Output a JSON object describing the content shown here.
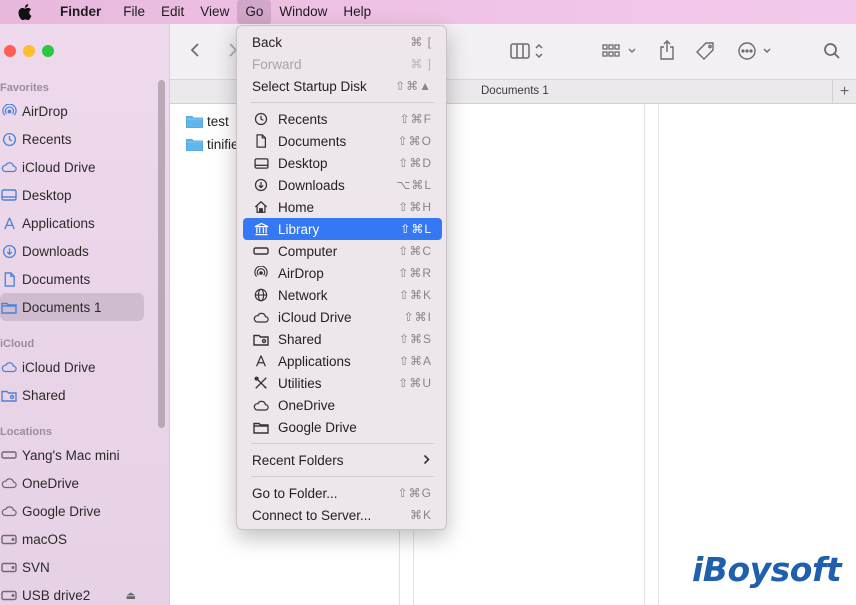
{
  "menubar": {
    "app": "Finder",
    "items": [
      "File",
      "Edit",
      "View",
      "Go",
      "Window",
      "Help"
    ],
    "active": "Go"
  },
  "sidebar": {
    "sections": {
      "favorites": "Favorites",
      "icloud": "iCloud",
      "locations": "Locations"
    },
    "favorites": [
      {
        "label": "AirDrop",
        "icon": "airdrop-icon"
      },
      {
        "label": "Recents",
        "icon": "clock-icon"
      },
      {
        "label": "iCloud Drive",
        "icon": "cloud-icon"
      },
      {
        "label": "Desktop",
        "icon": "desktop-icon"
      },
      {
        "label": "Applications",
        "icon": "applications-icon"
      },
      {
        "label": "Downloads",
        "icon": "download-icon"
      },
      {
        "label": "Documents",
        "icon": "document-icon"
      },
      {
        "label": "Documents 1",
        "icon": "folder-icon"
      }
    ],
    "icloud": [
      {
        "label": "iCloud Drive",
        "icon": "cloud-icon"
      },
      {
        "label": "Shared",
        "icon": "shared-folder-icon"
      }
    ],
    "locations": [
      {
        "label": "Yang's Mac mini",
        "icon": "computer-icon"
      },
      {
        "label": "OneDrive",
        "icon": "cloud-icon"
      },
      {
        "label": "Google Drive",
        "icon": "cloud-icon"
      },
      {
        "label": "macOS",
        "icon": "disk-icon"
      },
      {
        "label": "SVN",
        "icon": "disk-icon"
      },
      {
        "label": "USB drive2",
        "icon": "disk-icon"
      }
    ],
    "selected": "Documents 1"
  },
  "tabbar": {
    "title": "Documents 1",
    "add": "+"
  },
  "files": [
    {
      "name": "test"
    },
    {
      "name": "tinifie"
    }
  ],
  "gomenu": {
    "back": {
      "label": "Back",
      "shortcut": "⌘ ["
    },
    "forward": {
      "label": "Forward",
      "shortcut": "⌘ ]"
    },
    "startup": {
      "label": "Select Startup Disk",
      "shortcut": "⇧⌘▲"
    },
    "places": [
      {
        "label": "Recents",
        "shortcut": "⇧⌘F",
        "icon": "clock-icon"
      },
      {
        "label": "Documents",
        "shortcut": "⇧⌘O",
        "icon": "document-icon"
      },
      {
        "label": "Desktop",
        "shortcut": "⇧⌘D",
        "icon": "desktop-icon"
      },
      {
        "label": "Downloads",
        "shortcut": "⌥⌘L",
        "icon": "download-icon"
      },
      {
        "label": "Home",
        "shortcut": "⇧⌘H",
        "icon": "home-icon"
      },
      {
        "label": "Library",
        "shortcut": "⇧⌘L",
        "icon": "library-icon"
      },
      {
        "label": "Computer",
        "shortcut": "⇧⌘C",
        "icon": "computer-icon"
      },
      {
        "label": "AirDrop",
        "shortcut": "⇧⌘R",
        "icon": "airdrop-icon"
      },
      {
        "label": "Network",
        "shortcut": "⇧⌘K",
        "icon": "network-icon"
      },
      {
        "label": "iCloud Drive",
        "shortcut": "⇧⌘I",
        "icon": "cloud-icon"
      },
      {
        "label": "Shared",
        "shortcut": "⇧⌘S",
        "icon": "shared-folder-icon"
      },
      {
        "label": "Applications",
        "shortcut": "⇧⌘A",
        "icon": "applications-icon"
      },
      {
        "label": "Utilities",
        "shortcut": "⇧⌘U",
        "icon": "utilities-icon"
      },
      {
        "label": "OneDrive",
        "shortcut": "",
        "icon": "cloud-icon"
      },
      {
        "label": "Google Drive",
        "shortcut": "",
        "icon": "folder-icon"
      }
    ],
    "highlighted": "Library",
    "recent": {
      "label": "Recent Folders"
    },
    "goto": {
      "label": "Go to Folder...",
      "shortcut": "⇧⌘G"
    },
    "connect": {
      "label": "Connect to Server...",
      "shortcut": "⌘K"
    }
  },
  "watermark": "iBoysoft",
  "colors": {
    "highlight": "#3478f6",
    "folder": "#5fb6ec",
    "watermark": "#1f5fae"
  }
}
